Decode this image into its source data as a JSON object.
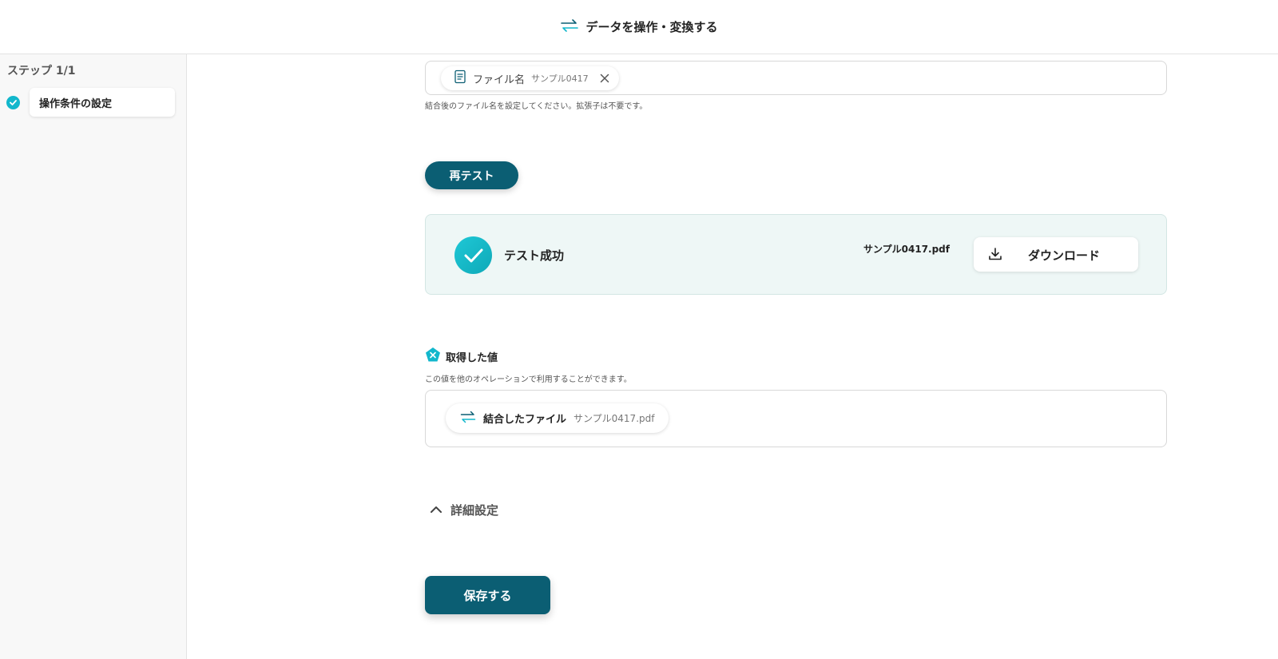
{
  "header": {
    "title": "データを操作・変換する",
    "icon": "swap-arrows-icon"
  },
  "sidebar": {
    "step_count": "ステップ 1/1",
    "steps": [
      {
        "label": "操作条件の設定",
        "status": "completed"
      }
    ]
  },
  "filename_field": {
    "token_label": "ファイル名",
    "token_value": "サンプル0417",
    "help": "結合後のファイル名を設定してください。拡張子は不要です。"
  },
  "retest_label": "再テスト",
  "result": {
    "status": "テスト成功",
    "filename": "サンプル0417.pdf",
    "download_label": "ダウンロード"
  },
  "values": {
    "title": "取得した値",
    "help": "この値を他のオペレーションで利用することができます。",
    "items": [
      {
        "label": "結合したファイル",
        "value": "サンプル0417.pdf"
      }
    ]
  },
  "advanced_label": "詳細設定",
  "save_label": "保存する",
  "colors": {
    "primary": "#0b5e73",
    "accent": "#12b7cc",
    "success_bg": "#eef7f6"
  }
}
